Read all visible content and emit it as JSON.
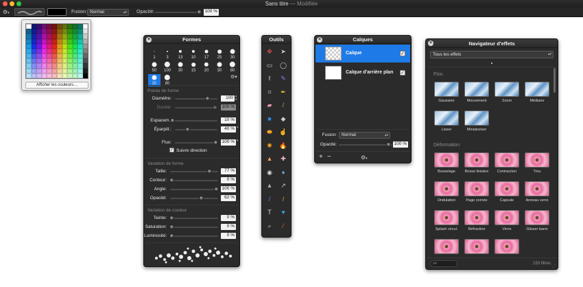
{
  "window": {
    "title": "Sans titre",
    "title_suffix": " — Modifiée"
  },
  "toolbar": {
    "fusion_label": "Fusion:",
    "fusion_value": "Normal",
    "opacity_label": "Opacité:",
    "opacity_value": "100 %"
  },
  "color_popup": {
    "show_colors_button": "Afficher les couleurs…"
  },
  "formes": {
    "title": "Formes",
    "brushes": [
      "1",
      "3",
      "13",
      "10",
      "17",
      "25",
      "30",
      "50",
      "100",
      "30",
      "15",
      "20",
      "30",
      "80",
      "30",
      "80"
    ],
    "section_point": "Pointe de forme",
    "diametre_label": "Diamètre:",
    "diametre_value": "100",
    "durete_label": "Dureté:",
    "durete_value": "100 %",
    "espacem_label": "Espacem.:",
    "espacem_value": "10 %",
    "eparpill_label": "Éparpill.:",
    "eparpill_value": "40 %",
    "flux_label": "Flux:",
    "flux_value": "100 %",
    "suivre_label": "Suivre direction",
    "section_forme": "Variation de forme",
    "taille_label": "Taille:",
    "taille_value": "77 %",
    "contour_label": "Contour:",
    "contour_value": "0 %",
    "angle_label": "Angle:",
    "angle_value": "100 %",
    "opacite_label": "Opacité:",
    "opacite_value": "62 %",
    "section_couleur": "Variation de couleur",
    "teinte_label": "Teinte:",
    "teinte_value": "0 %",
    "saturation_label": "Saturation:",
    "saturation_value": "0 %",
    "luminosite_label": "Luminosité:",
    "luminosite_value": "0 %"
  },
  "outils": {
    "title": "Outils"
  },
  "calques": {
    "title": "Calques",
    "layer1": "Calque",
    "layer2": "Calque d'arrière plan",
    "fusion_label": "Fusion:",
    "fusion_value": "Normal",
    "opacity_label": "Opacité:",
    "opacity_value": "100 %",
    "add_symbol": "+",
    "remove_symbol": "−"
  },
  "effets": {
    "title": "Navigateur d'effets",
    "filter_value": "Tous les effets",
    "section_flou": "Flou",
    "flou_items": [
      "Gaussien",
      "Mouvement",
      "Zoom",
      "Médiane",
      "Lisser",
      "Miniaturiser"
    ],
    "section_deformation": "Déformation",
    "deformation_items": [
      "Bosselage",
      "Bosse linéaire",
      "Contraction",
      "Trou",
      "Ondulation",
      "Page cornée",
      "Capsule",
      "Anneau verre",
      "Splash circul.",
      "Réfraction",
      "Verre",
      "Glisser barre"
    ],
    "count": "153 filtres"
  }
}
